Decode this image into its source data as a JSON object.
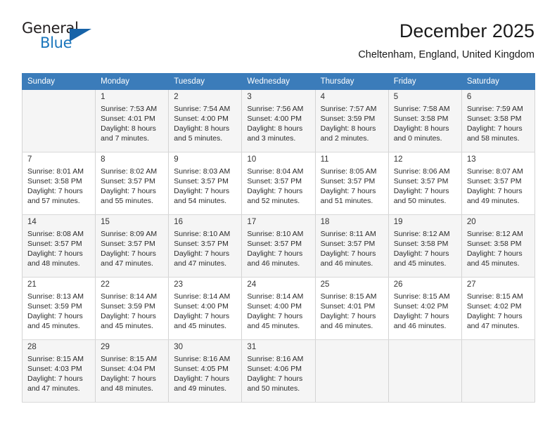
{
  "brand": {
    "name_top": "General",
    "name_bottom": "Blue",
    "accent_color": "#1b76bc",
    "triangle_color": "#1763a8"
  },
  "header": {
    "title": "December 2025",
    "subtitle": "Cheltenham, England, United Kingdom"
  },
  "calendar": {
    "header_bg": "#3b7cba",
    "weekdays": [
      "Sunday",
      "Monday",
      "Tuesday",
      "Wednesday",
      "Thursday",
      "Friday",
      "Saturday"
    ],
    "weeks": [
      [
        {
          "day": "",
          "lines": []
        },
        {
          "day": "1",
          "lines": [
            "Sunrise: 7:53 AM",
            "Sunset: 4:01 PM",
            "Daylight: 8 hours",
            "and 7 minutes."
          ]
        },
        {
          "day": "2",
          "lines": [
            "Sunrise: 7:54 AM",
            "Sunset: 4:00 PM",
            "Daylight: 8 hours",
            "and 5 minutes."
          ]
        },
        {
          "day": "3",
          "lines": [
            "Sunrise: 7:56 AM",
            "Sunset: 4:00 PM",
            "Daylight: 8 hours",
            "and 3 minutes."
          ]
        },
        {
          "day": "4",
          "lines": [
            "Sunrise: 7:57 AM",
            "Sunset: 3:59 PM",
            "Daylight: 8 hours",
            "and 2 minutes."
          ]
        },
        {
          "day": "5",
          "lines": [
            "Sunrise: 7:58 AM",
            "Sunset: 3:58 PM",
            "Daylight: 8 hours",
            "and 0 minutes."
          ]
        },
        {
          "day": "6",
          "lines": [
            "Sunrise: 7:59 AM",
            "Sunset: 3:58 PM",
            "Daylight: 7 hours",
            "and 58 minutes."
          ]
        }
      ],
      [
        {
          "day": "7",
          "lines": [
            "Sunrise: 8:01 AM",
            "Sunset: 3:58 PM",
            "Daylight: 7 hours",
            "and 57 minutes."
          ]
        },
        {
          "day": "8",
          "lines": [
            "Sunrise: 8:02 AM",
            "Sunset: 3:57 PM",
            "Daylight: 7 hours",
            "and 55 minutes."
          ]
        },
        {
          "day": "9",
          "lines": [
            "Sunrise: 8:03 AM",
            "Sunset: 3:57 PM",
            "Daylight: 7 hours",
            "and 54 minutes."
          ]
        },
        {
          "day": "10",
          "lines": [
            "Sunrise: 8:04 AM",
            "Sunset: 3:57 PM",
            "Daylight: 7 hours",
            "and 52 minutes."
          ]
        },
        {
          "day": "11",
          "lines": [
            "Sunrise: 8:05 AM",
            "Sunset: 3:57 PM",
            "Daylight: 7 hours",
            "and 51 minutes."
          ]
        },
        {
          "day": "12",
          "lines": [
            "Sunrise: 8:06 AM",
            "Sunset: 3:57 PM",
            "Daylight: 7 hours",
            "and 50 minutes."
          ]
        },
        {
          "day": "13",
          "lines": [
            "Sunrise: 8:07 AM",
            "Sunset: 3:57 PM",
            "Daylight: 7 hours",
            "and 49 minutes."
          ]
        }
      ],
      [
        {
          "day": "14",
          "lines": [
            "Sunrise: 8:08 AM",
            "Sunset: 3:57 PM",
            "Daylight: 7 hours",
            "and 48 minutes."
          ]
        },
        {
          "day": "15",
          "lines": [
            "Sunrise: 8:09 AM",
            "Sunset: 3:57 PM",
            "Daylight: 7 hours",
            "and 47 minutes."
          ]
        },
        {
          "day": "16",
          "lines": [
            "Sunrise: 8:10 AM",
            "Sunset: 3:57 PM",
            "Daylight: 7 hours",
            "and 47 minutes."
          ]
        },
        {
          "day": "17",
          "lines": [
            "Sunrise: 8:10 AM",
            "Sunset: 3:57 PM",
            "Daylight: 7 hours",
            "and 46 minutes."
          ]
        },
        {
          "day": "18",
          "lines": [
            "Sunrise: 8:11 AM",
            "Sunset: 3:57 PM",
            "Daylight: 7 hours",
            "and 46 minutes."
          ]
        },
        {
          "day": "19",
          "lines": [
            "Sunrise: 8:12 AM",
            "Sunset: 3:58 PM",
            "Daylight: 7 hours",
            "and 45 minutes."
          ]
        },
        {
          "day": "20",
          "lines": [
            "Sunrise: 8:12 AM",
            "Sunset: 3:58 PM",
            "Daylight: 7 hours",
            "and 45 minutes."
          ]
        }
      ],
      [
        {
          "day": "21",
          "lines": [
            "Sunrise: 8:13 AM",
            "Sunset: 3:59 PM",
            "Daylight: 7 hours",
            "and 45 minutes."
          ]
        },
        {
          "day": "22",
          "lines": [
            "Sunrise: 8:14 AM",
            "Sunset: 3:59 PM",
            "Daylight: 7 hours",
            "and 45 minutes."
          ]
        },
        {
          "day": "23",
          "lines": [
            "Sunrise: 8:14 AM",
            "Sunset: 4:00 PM",
            "Daylight: 7 hours",
            "and 45 minutes."
          ]
        },
        {
          "day": "24",
          "lines": [
            "Sunrise: 8:14 AM",
            "Sunset: 4:00 PM",
            "Daylight: 7 hours",
            "and 45 minutes."
          ]
        },
        {
          "day": "25",
          "lines": [
            "Sunrise: 8:15 AM",
            "Sunset: 4:01 PM",
            "Daylight: 7 hours",
            "and 46 minutes."
          ]
        },
        {
          "day": "26",
          "lines": [
            "Sunrise: 8:15 AM",
            "Sunset: 4:02 PM",
            "Daylight: 7 hours",
            "and 46 minutes."
          ]
        },
        {
          "day": "27",
          "lines": [
            "Sunrise: 8:15 AM",
            "Sunset: 4:02 PM",
            "Daylight: 7 hours",
            "and 47 minutes."
          ]
        }
      ],
      [
        {
          "day": "28",
          "lines": [
            "Sunrise: 8:15 AM",
            "Sunset: 4:03 PM",
            "Daylight: 7 hours",
            "and 47 minutes."
          ]
        },
        {
          "day": "29",
          "lines": [
            "Sunrise: 8:15 AM",
            "Sunset: 4:04 PM",
            "Daylight: 7 hours",
            "and 48 minutes."
          ]
        },
        {
          "day": "30",
          "lines": [
            "Sunrise: 8:16 AM",
            "Sunset: 4:05 PM",
            "Daylight: 7 hours",
            "and 49 minutes."
          ]
        },
        {
          "day": "31",
          "lines": [
            "Sunrise: 8:16 AM",
            "Sunset: 4:06 PM",
            "Daylight: 7 hours",
            "and 50 minutes."
          ]
        },
        {
          "day": "",
          "lines": []
        },
        {
          "day": "",
          "lines": []
        },
        {
          "day": "",
          "lines": []
        }
      ]
    ]
  }
}
